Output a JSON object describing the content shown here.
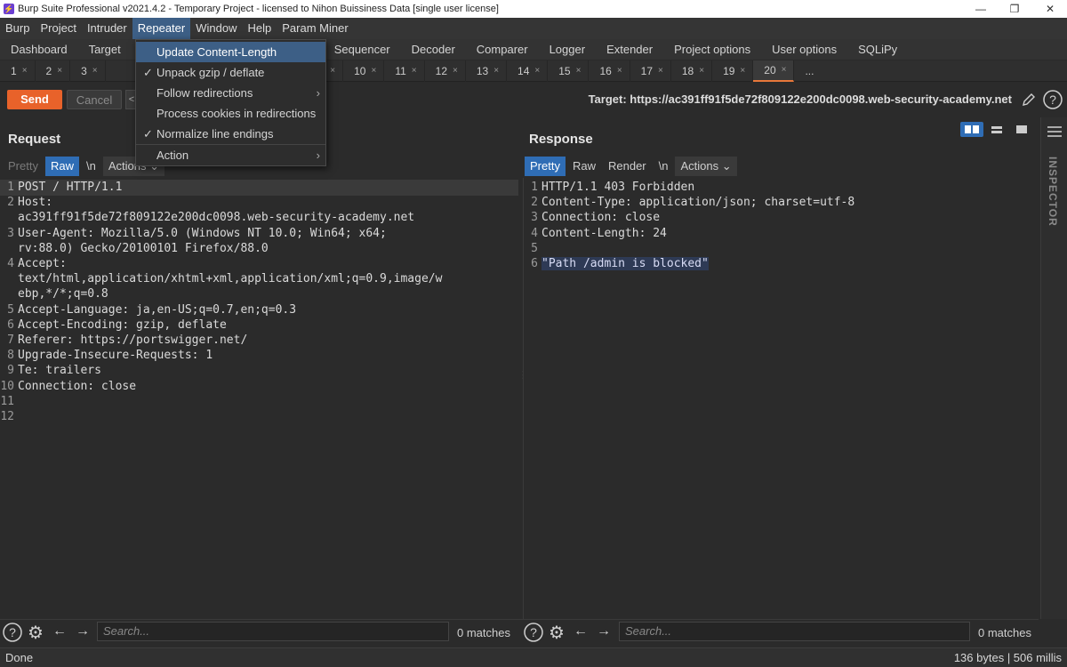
{
  "window": {
    "title": "Burp Suite Professional v2021.4.2 - Temporary Project - licensed to Nihon Buissiness Data [single user license]"
  },
  "menubar": [
    "Burp",
    "Project",
    "Intruder",
    "Repeater",
    "Window",
    "Help",
    "Param Miner"
  ],
  "tooltabs": [
    "Dashboard",
    "Target",
    "Sequencer",
    "Decoder",
    "Comparer",
    "Logger",
    "Extender",
    "Project options",
    "User options",
    "SQLiPy"
  ],
  "repeater_tabs": {
    "left": [
      "1",
      "2",
      "3"
    ],
    "right": [
      "9",
      "10",
      "11",
      "12",
      "13",
      "14",
      "15",
      "16",
      "17",
      "18",
      "19",
      "20"
    ],
    "more": "...",
    "close_glyph": "×",
    "active": "20"
  },
  "dropdown": {
    "items": [
      {
        "label": "Update Content-Length",
        "checked": false,
        "submenu": false,
        "selected": true
      },
      {
        "label": "Unpack gzip / deflate",
        "checked": true,
        "submenu": false
      },
      {
        "label": "Follow redirections",
        "checked": false,
        "submenu": true
      },
      {
        "label": "Process cookies in redirections",
        "checked": false,
        "submenu": false
      },
      {
        "label": "Normalize line endings",
        "checked": true,
        "submenu": false
      },
      {
        "label": "Action",
        "checked": false,
        "submenu": true
      }
    ]
  },
  "actions": {
    "send": "Send",
    "cancel": "Cancel"
  },
  "target": {
    "label": "Target: https://ac391ff91f5de72f809122e200dc0098.web-security-academy.net"
  },
  "request": {
    "title": "Request",
    "tabs": [
      "Pretty",
      "Raw",
      "\\n",
      "Actions"
    ],
    "lines": [
      {
        "n": "1",
        "t": "POST / HTTP/1.1"
      },
      {
        "n": "2",
        "t": "Host:"
      },
      {
        "n": "",
        "t": "ac391ff91f5de72f809122e200dc0098.web-security-academy.net"
      },
      {
        "n": "3",
        "t": "User-Agent: Mozilla/5.0 (Windows NT 10.0; Win64; x64;"
      },
      {
        "n": "",
        "t": "rv:88.0) Gecko/20100101 Firefox/88.0"
      },
      {
        "n": "4",
        "t": "Accept:"
      },
      {
        "n": "",
        "t": "text/html,application/xhtml+xml,application/xml;q=0.9,image/w"
      },
      {
        "n": "",
        "t": "ebp,*/*;q=0.8"
      },
      {
        "n": "5",
        "t": "Accept-Language: ja,en-US;q=0.7,en;q=0.3"
      },
      {
        "n": "6",
        "t": "Accept-Encoding: gzip, deflate"
      },
      {
        "n": "7",
        "t": "Referer: https://portswigger.net/"
      },
      {
        "n": "8",
        "t": "Upgrade-Insecure-Requests: 1"
      },
      {
        "n": "9",
        "t": "Te: trailers"
      },
      {
        "n": "10",
        "t": "Connection: close"
      },
      {
        "n": "11",
        "t": ""
      },
      {
        "n": "12",
        "t": ""
      }
    ],
    "search_placeholder": "Search...",
    "matches": "0 matches"
  },
  "response": {
    "title": "Response",
    "tabs": [
      "Pretty",
      "Raw",
      "Render",
      "\\n",
      "Actions"
    ],
    "lines": [
      {
        "n": "1",
        "t": "HTTP/1.1 403 Forbidden"
      },
      {
        "n": "2",
        "t": "Content-Type: application/json; charset=utf-8"
      },
      {
        "n": "3",
        "t": "Connection: close"
      },
      {
        "n": "4",
        "t": "Content-Length: 24"
      },
      {
        "n": "5",
        "t": ""
      },
      {
        "n": "6",
        "t": "\"Path /admin is blocked\""
      }
    ],
    "search_placeholder": "Search...",
    "matches": "0 matches"
  },
  "inspector": {
    "label": "INSPECTOR"
  },
  "status": {
    "left": "Done",
    "right": "136 bytes | 506 millis"
  }
}
